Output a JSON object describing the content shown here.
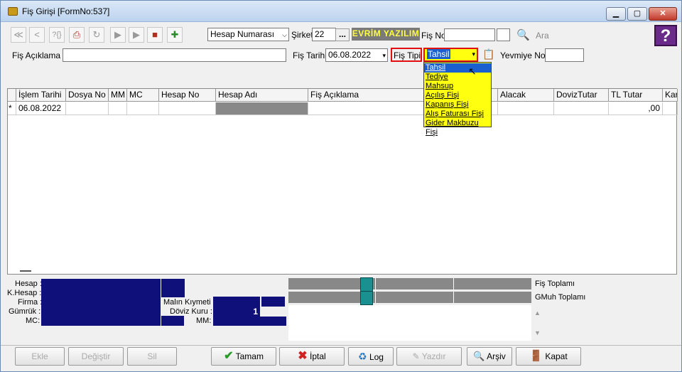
{
  "window": {
    "title": "Fiş Girişi [FormNo:537]",
    "min": "▁",
    "max": "▢",
    "close": "✕"
  },
  "toolbar": {
    "icons": [
      "arrow-left-end-icon",
      "arrow-left-icon",
      "info-icon",
      "print-icon",
      "refresh-icon",
      "arrow-right-icon",
      "arrow-right-end-icon",
      "delete-record-icon",
      "add-record-icon"
    ],
    "search_type": "Hesap Numarası",
    "sirket_label": "Şirket",
    "sirket_value": "22",
    "sirket_button": "...",
    "company_name": "EVRİM YAZILIM",
    "fis_no_label": "Fiş No",
    "fis_no_value": "",
    "ara_label": "Ara",
    "help": "?"
  },
  "form": {
    "aciklama_label": "Fiş Açıklama :",
    "aciklama_value": "",
    "tarih_label": "Fiş Tarihi",
    "tarih_value": "06.08.2022",
    "fis_tipi_label": "Fiş Tipi",
    "fis_tipi_value": "Tahsil",
    "yevmiye_label": "Yevmiye No",
    "yevmiye_value": ""
  },
  "dropdown": {
    "options": [
      "Tahsil",
      "Tediye",
      "Mahsup",
      "Açılış Fişi",
      "Kapanış Fişi",
      "Alış Faturası Fişi",
      "Gider Makbuzu Fişi"
    ],
    "selected": "Tahsil"
  },
  "grid": {
    "columns": [
      "İşlem Tarihi",
      "Dosya No",
      "MM",
      "MC",
      "Hesap No",
      "Hesap Adı",
      "Fiş Açıklama",
      "Alacak",
      "DovizTutar",
      "TL Tutar",
      "Kar"
    ],
    "row": {
      "marker": "*",
      "date": "06.08.2022",
      "tl_tutar": ",00"
    }
  },
  "summary": {
    "hesap_label": "Hesap :",
    "khesap_label": "K.Hesap :",
    "firma_label": "Firma :",
    "gumruk_label": "Gümrük :",
    "mc_label": "MC:",
    "malin_label": "Malın Kıymeti :",
    "doviz_label": "Döviz Kuru :",
    "mm_label": "MM:",
    "doviz_value": "1",
    "fis_toplami": "Fiş Toplamı",
    "gmuh_toplami": "GMuh Toplamı",
    "scroll_up": "▲",
    "scroll_down": "▼"
  },
  "buttons": {
    "ekle": "Ekle",
    "degistir": "Değiştir",
    "sil": "Sil",
    "tamam": "Tamam",
    "iptal": "İptal",
    "log": "Log",
    "yazdir": "Yazdır",
    "arsiv": "Arşiv",
    "kapat": "Kapat"
  }
}
